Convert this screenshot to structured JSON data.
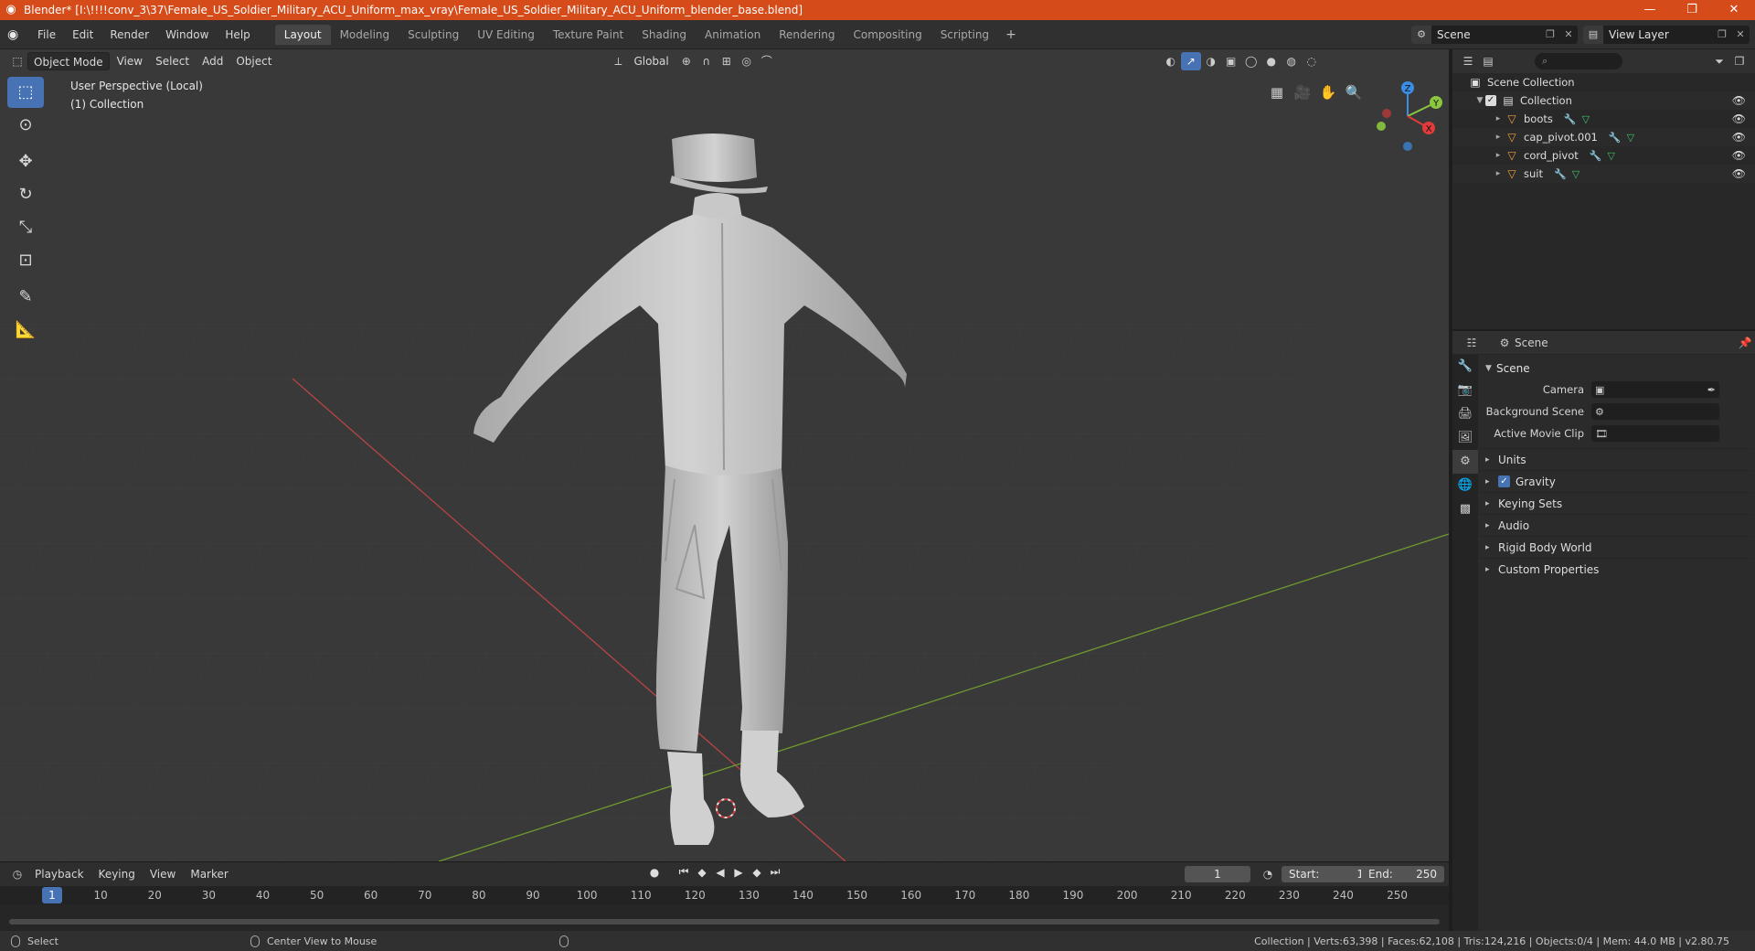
{
  "window": {
    "title": "Blender* [I:\\!!!!conv_3\\37\\Female_US_Soldier_Military_ACU_Uniform_max_vray\\Female_US_Soldier_Military_ACU_Uniform_blender_base.blend]",
    "minimize": "—",
    "restore": "❐",
    "close": "✕"
  },
  "menu": [
    "File",
    "Edit",
    "Render",
    "Window",
    "Help"
  ],
  "workspaces": [
    {
      "label": "Layout",
      "active": true
    },
    {
      "label": "Modeling"
    },
    {
      "label": "Sculpting"
    },
    {
      "label": "UV Editing"
    },
    {
      "label": "Texture Paint"
    },
    {
      "label": "Shading"
    },
    {
      "label": "Animation"
    },
    {
      "label": "Rendering"
    },
    {
      "label": "Compositing"
    },
    {
      "label": "Scripting"
    }
  ],
  "topbar": {
    "scene": "Scene",
    "view_layer": "View Layer",
    "add_workspace": "+"
  },
  "viewport": {
    "mode": "Object Mode",
    "menus": [
      "View",
      "Select",
      "Add",
      "Object"
    ],
    "transform_orientation": "Global",
    "info_line1": "User Perspective (Local)",
    "info_line2": "(1) Collection",
    "gizmo": {
      "x": "X",
      "y": "Y",
      "z": "Z"
    }
  },
  "timeline": {
    "menus": [
      "Playback",
      "Keying",
      "View",
      "Marker"
    ],
    "current_frame": "1",
    "start_label": "Start:",
    "start": "1",
    "end_label": "End:",
    "end": "250",
    "ruler": [
      "1",
      "10",
      "20",
      "30",
      "40",
      "50",
      "60",
      "70",
      "80",
      "90",
      "100",
      "110",
      "120",
      "130",
      "140",
      "150",
      "160",
      "170",
      "180",
      "190",
      "200",
      "210",
      "220",
      "230",
      "240",
      "250"
    ]
  },
  "statusbar": {
    "left1": "Select",
    "left2": "Center View to Mouse",
    "right": "Collection | Verts:63,398 | Faces:62,108 | Tris:124,216 | Objects:0/4 | Mem: 44.0 MB | v2.80.75"
  },
  "outliner": {
    "root": "Scene Collection",
    "collection": "Collection",
    "objects": [
      "boots",
      "cap_pivot.001",
      "cord_pivot",
      "suit"
    ]
  },
  "properties": {
    "header": "Scene",
    "panel": "Scene",
    "camera_label": "Camera",
    "bg_scene_label": "Background Scene",
    "movie_clip_label": "Active Movie Clip",
    "subpanels": [
      "Units",
      "Gravity",
      "Keying Sets",
      "Audio",
      "Rigid Body World",
      "Custom Properties"
    ]
  },
  "colors": {
    "accent": "#4772b3",
    "titlebar": "#d54b1a",
    "x_axis": "#e23b3b",
    "y_axis": "#8cc63f",
    "z_axis": "#3a8ee6"
  }
}
